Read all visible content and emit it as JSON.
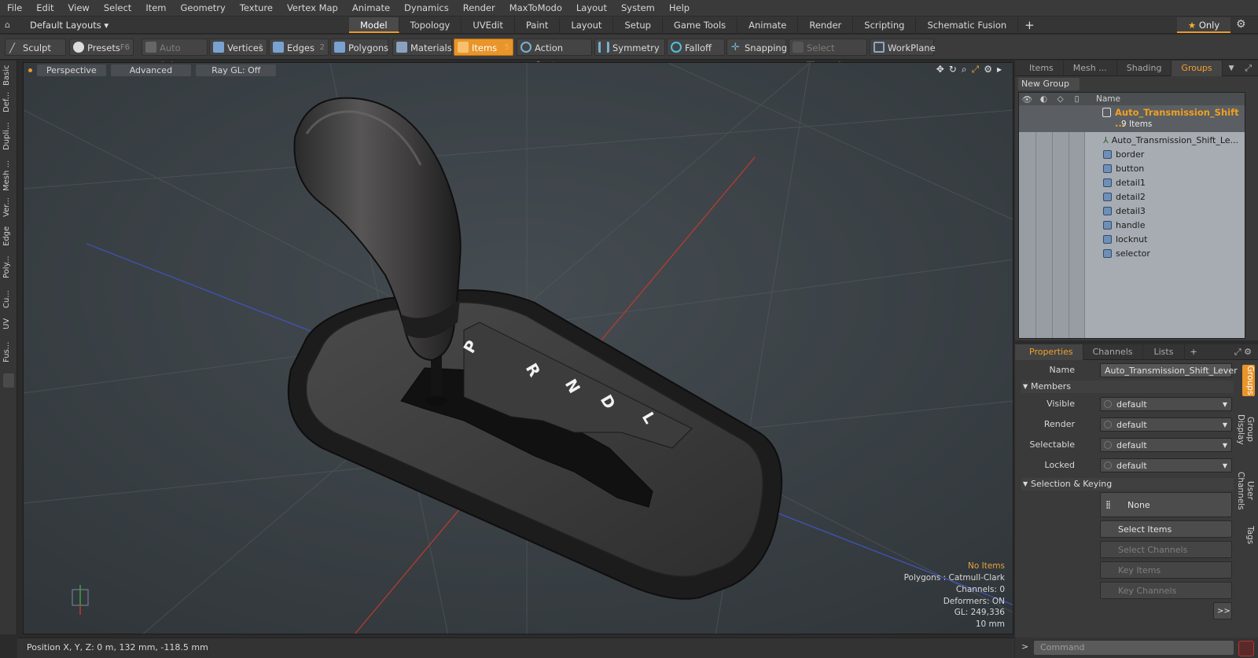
{
  "menu": [
    "File",
    "Edit",
    "View",
    "Select",
    "Item",
    "Geometry",
    "Texture",
    "Vertex Map",
    "Animate",
    "Dynamics",
    "Render",
    "MaxToModo",
    "Layout",
    "System",
    "Help"
  ],
  "layouts": {
    "label": "Default Layouts ▾"
  },
  "tabs": [
    "Model",
    "Topology",
    "UVEdit",
    "Paint",
    "Layout",
    "Setup",
    "Game Tools",
    "Animate",
    "Render",
    "Scripting",
    "Schematic Fusion"
  ],
  "only_label": "Only",
  "toolbar": {
    "sculpt": "Sculpt",
    "presets": "Presets",
    "presets_key": "F6",
    "auto_select": "Auto Select",
    "vertices": "Vertices",
    "vertices_key": "1",
    "edges": "Edges",
    "edges_key": "2",
    "polygons": "Polygons",
    "materials": "Materials",
    "items": "Items",
    "items_key": "5",
    "action_center": "Action Center",
    "symmetry": "Symmetry",
    "falloff": "Falloff",
    "snapping": "Snapping",
    "select_through": "Select Through",
    "workplane": "WorkPlane"
  },
  "left_tabs": [
    "Basic",
    "Def...",
    "Dupli...",
    "Mesh ...",
    "Ver...",
    "Edge",
    "Poly...",
    "Cu...",
    "UV",
    "Fus..."
  ],
  "viewport": {
    "perspective": "Perspective",
    "advanced": "Advanced",
    "raygl": "Ray GL: Off",
    "stats": {
      "no_items": "No Items",
      "polygons": "Polygons : Catmull-Clark",
      "channels": "Channels: 0",
      "deformers": "Deformers: ON",
      "gl": "GL: 249,336",
      "scale": "10 mm"
    },
    "shift_letters": [
      "P",
      "R",
      "N",
      "D",
      "L"
    ]
  },
  "status": {
    "position": "Position X, Y, Z:   0 m, 132 mm, -118.5 mm"
  },
  "groups_panel": {
    "tabs": [
      "Items",
      "Mesh ...",
      "Shading",
      "Groups"
    ],
    "new_group": "New Group",
    "col_name": "Name",
    "group_name": "Auto_Transmission_Shift ...",
    "group_count": "9 Items",
    "items": [
      "Auto_Transmission_Shift_Le...",
      "border",
      "button",
      "detail1",
      "detail2",
      "detail3",
      "handle",
      "locknut",
      "selector"
    ]
  },
  "properties_panel": {
    "tabs": [
      "Properties",
      "Channels",
      "Lists"
    ],
    "name_label": "Name",
    "name_value": "Auto_Transmission_Shift_Lever (:",
    "members_section": "Members",
    "visible_label": "Visible",
    "visible_value": "default",
    "render_label": "Render",
    "render_value": "default",
    "selectable_label": "Selectable",
    "selectable_value": "default",
    "locked_label": "Locked",
    "locked_value": "default",
    "selkey_section": "Selection & Keying",
    "none_label": "None",
    "select_items": "Select Items",
    "select_channels": "Select Channels",
    "key_items": "Key Items",
    "key_channels": "Key Channels",
    "more": ">>",
    "side_tabs": [
      "Groups",
      "Group Display",
      "User Channels",
      "Tags"
    ]
  },
  "command": {
    "placeholder": "Command"
  },
  "colors": {
    "accent": "#e8952a",
    "group_name": "#f0a020",
    "viewport_bg": "#3a4044"
  }
}
